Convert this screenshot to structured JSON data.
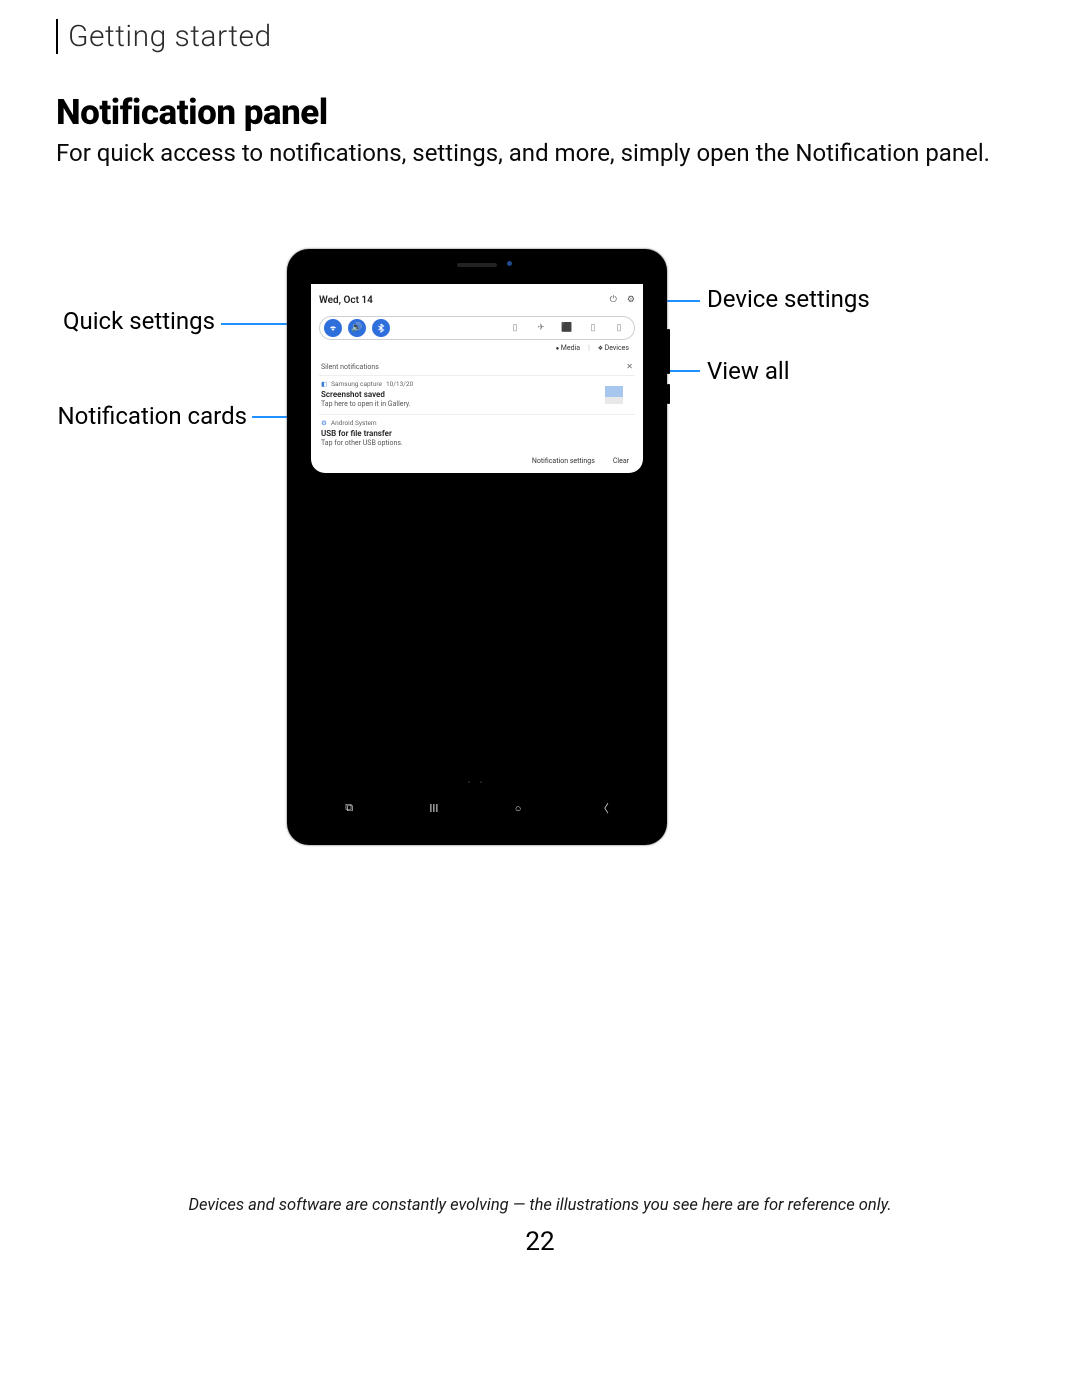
{
  "header": {
    "breadcrumb": "Getting started"
  },
  "section": {
    "title": "Notification panel",
    "body": "For quick access to notifications, settings, and more, simply open the Notification panel."
  },
  "callouts": {
    "quick_settings": "Quick settings",
    "notification_cards": "Notification cards",
    "device_settings": "Device settings",
    "view_all": "View all"
  },
  "panel": {
    "date": "Wed, Oct 14",
    "sub_labels": {
      "media": "Media",
      "devices": "Devices"
    },
    "silent_header": "Silent notifications",
    "notifications": [
      {
        "app": "Samsung capture",
        "time": "10/13/20",
        "title": "Screenshot saved",
        "sub": "Tap here to open it in Gallery."
      },
      {
        "app": "Android System",
        "title": "USB for file transfer",
        "sub": "Tap for other USB options."
      }
    ],
    "footer": {
      "settings": "Notification settings",
      "clear": "Clear"
    }
  },
  "footer": {
    "disclaimer": "Devices and software are constantly evolving — the illustrations you see here are for reference only.",
    "page": "22"
  }
}
